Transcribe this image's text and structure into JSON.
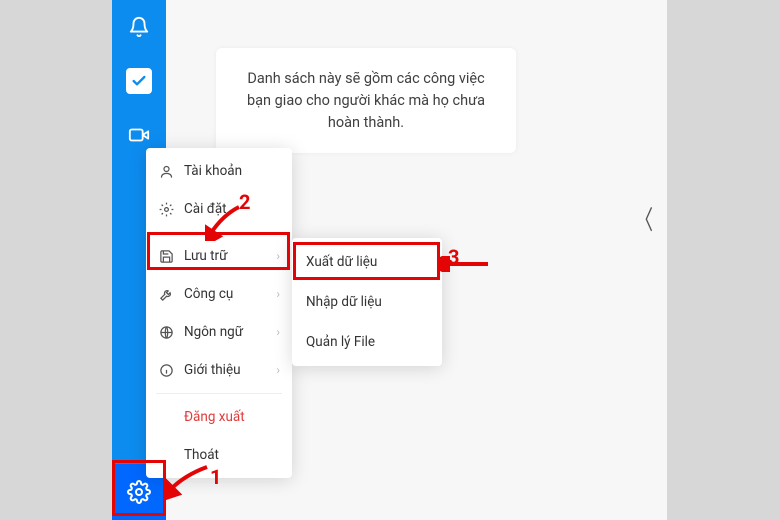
{
  "info_text": "Danh sách này sẽ gồm các công việc bạn giao cho người khác mà họ chưa hoàn thành.",
  "menu1": {
    "account": "Tài khoản",
    "settings": "Cài đặt",
    "storage": "Lưu trữ",
    "tools": "Công cụ",
    "language": "Ngôn ngữ",
    "about": "Giới thiệu",
    "logout": "Đăng xuất",
    "exit": "Thoát"
  },
  "menu2": {
    "export": "Xuất dữ liệu",
    "import": "Nhập dữ liệu",
    "manage": "Quản lý File"
  },
  "annotations": {
    "n1": "1",
    "n2": "2",
    "n3": "3"
  }
}
